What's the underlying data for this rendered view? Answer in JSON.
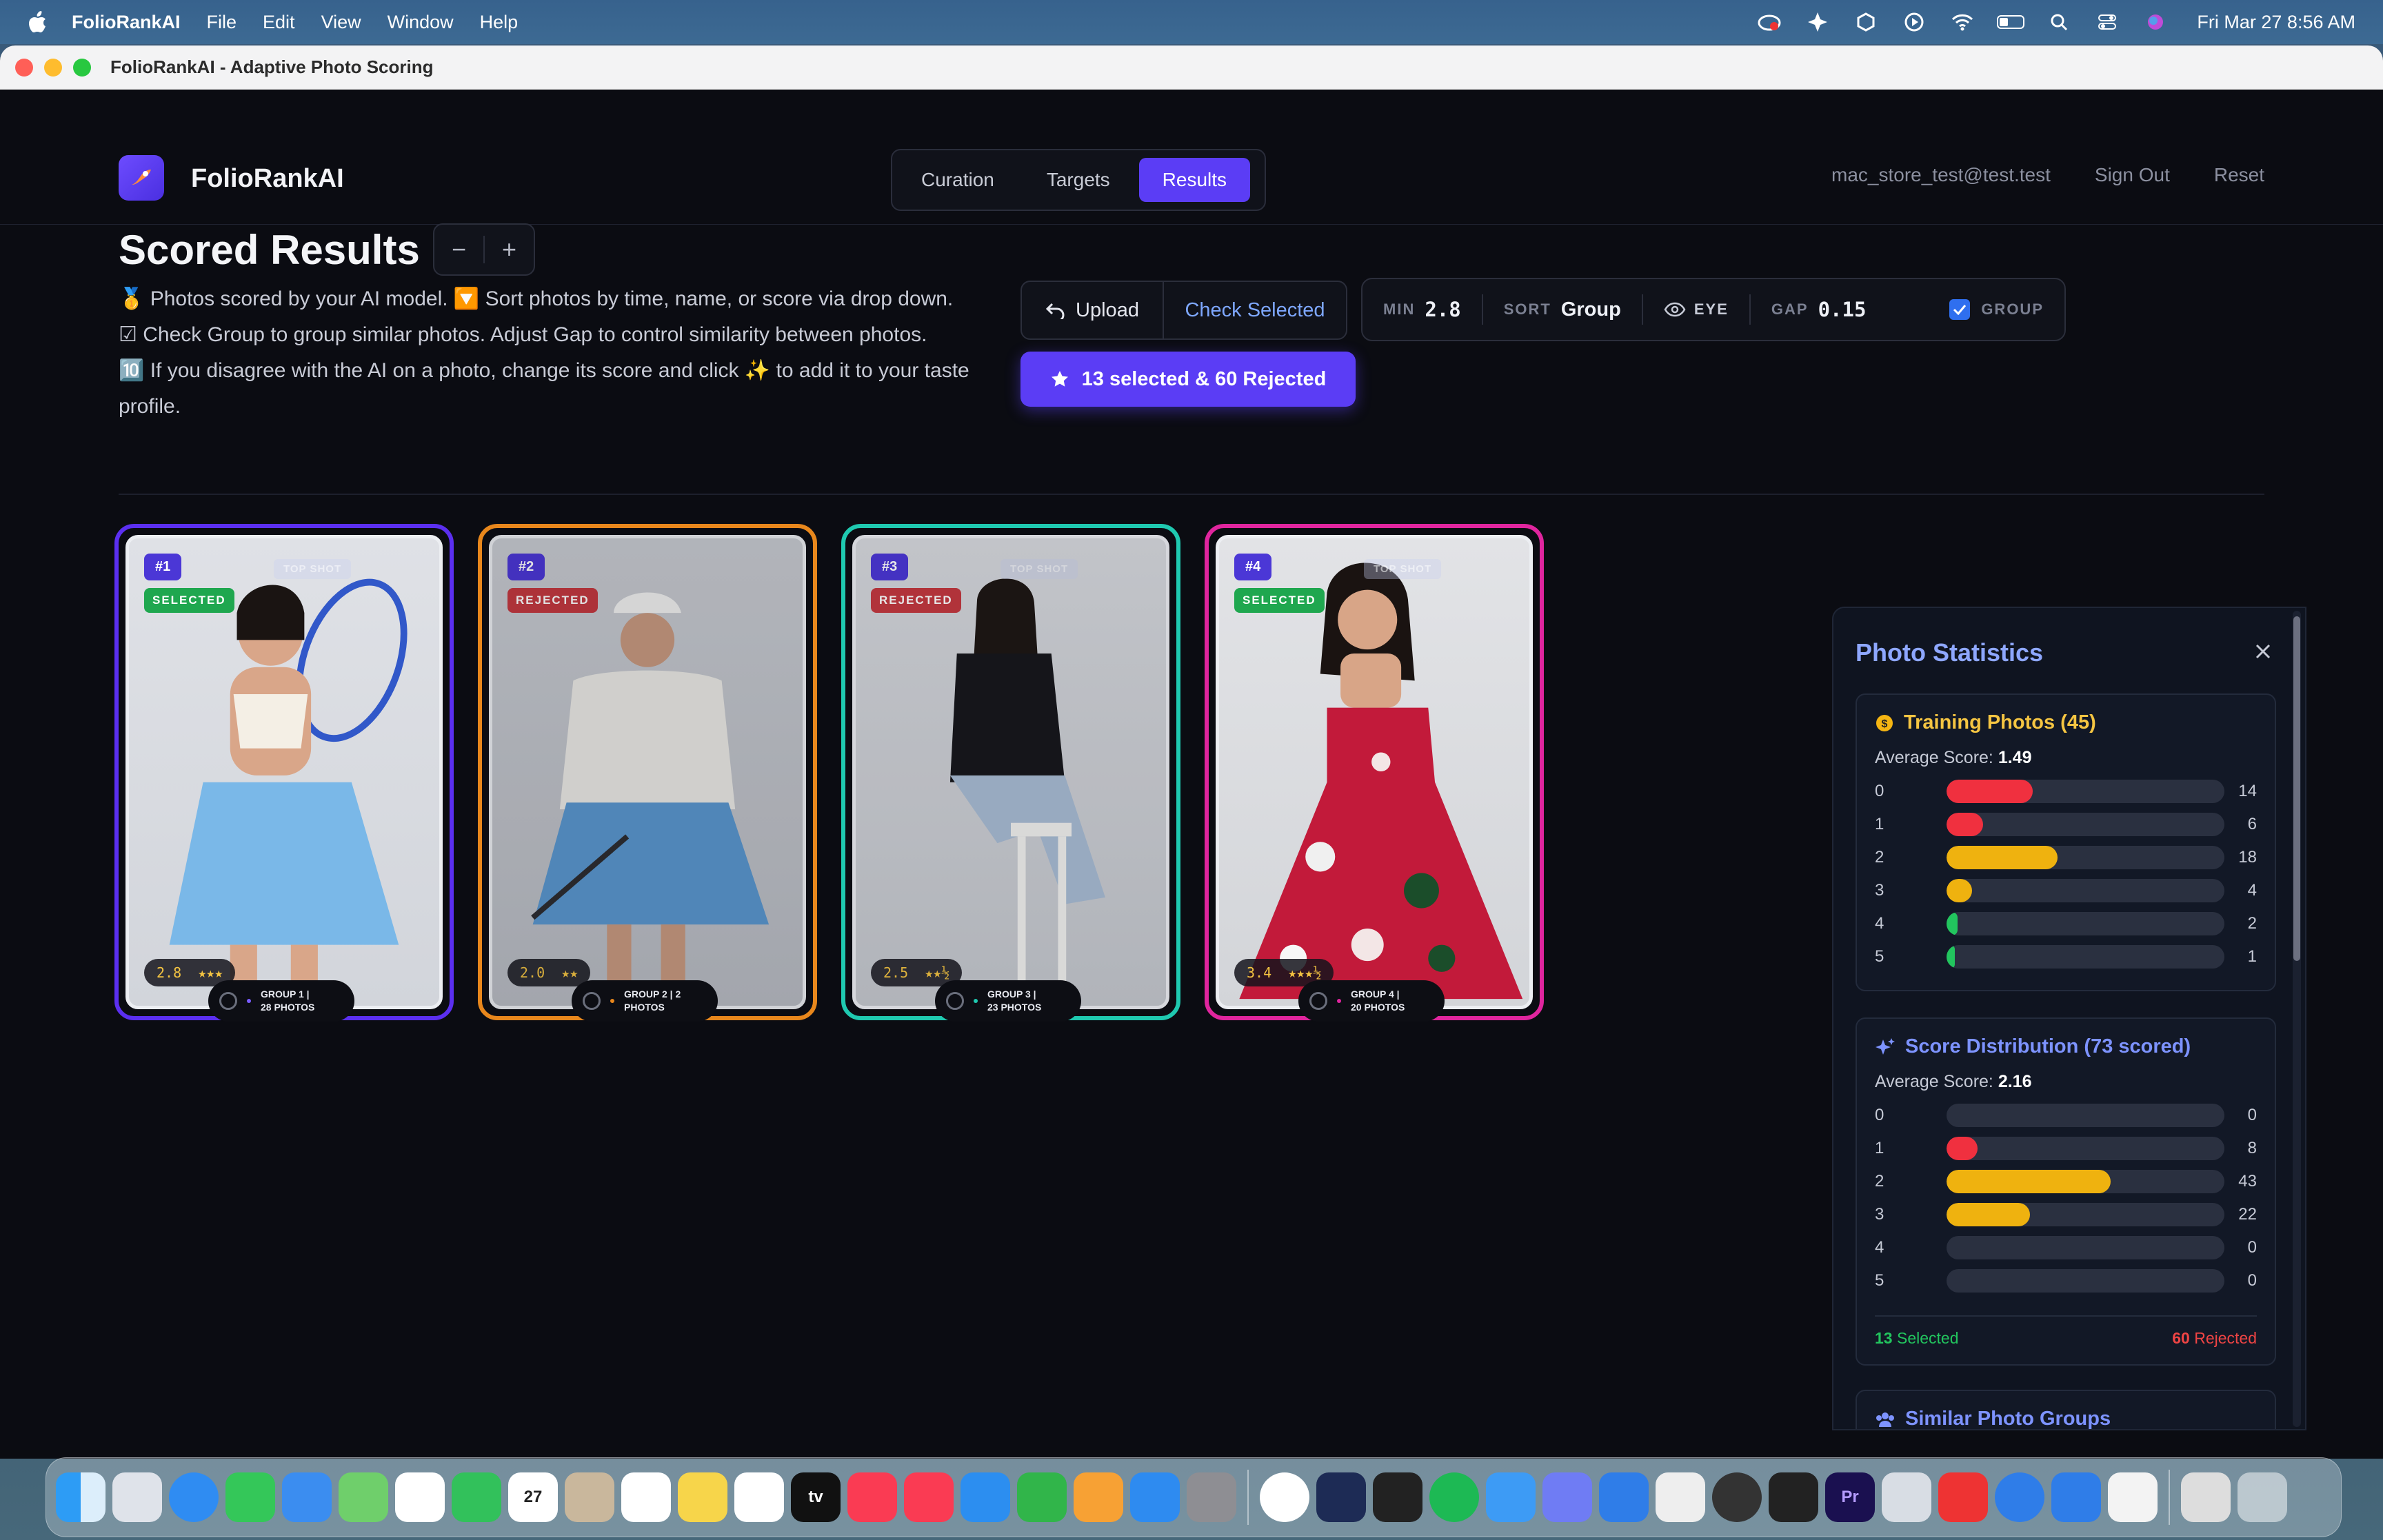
{
  "menubar": {
    "app_name": "FolioRankAI",
    "menus": [
      "File",
      "Edit",
      "View",
      "Window",
      "Help"
    ],
    "clock": "Fri Mar 27  8:56 AM"
  },
  "window": {
    "title": "FolioRankAI - Adaptive Photo Scoring"
  },
  "header": {
    "brand": "FolioRankAI",
    "tabs": [
      {
        "label": "Curation",
        "active": false
      },
      {
        "label": "Targets",
        "active": false
      },
      {
        "label": "Results",
        "active": true
      }
    ],
    "user_email": "mac_store_test@test.test",
    "sign_out": "Sign Out",
    "reset": "Reset"
  },
  "main": {
    "title": "Scored Results",
    "zoom_minus": "−",
    "zoom_plus": "+",
    "description": [
      "🥇 Photos scored by your AI model. 🔽 Sort photos by time, name, or score via drop down.",
      "☑ Check Group to group similar photos. Adjust Gap to control similarity between photos.",
      "🔟 If you disagree with the AI on a photo, change its score and click ✨ to add it to your taste profile."
    ],
    "upload_label": "Upload",
    "check_selected_label": "Check Selected",
    "filters": {
      "min_label": "MIN",
      "min_value": "2.8",
      "sort_label": "SORT",
      "sort_value": "Group",
      "eye_label": "EYE",
      "gap_label": "GAP",
      "gap_value": "0.15",
      "group_label": "GROUP",
      "group_checked": true
    },
    "selected_summary": "13 selected & 60 Rejected"
  },
  "cards": [
    {
      "rank": "#1",
      "status": "SELECTED",
      "top_shot": "TOP SHOT",
      "score": "2.8",
      "stars": "★★★",
      "group_line1": "GROUP 1 |",
      "group_line2": "28 PHOTOS",
      "border": "#5b2ff0"
    },
    {
      "rank": "#2",
      "status": "REJECTED",
      "top_shot": "",
      "score": "2.0",
      "stars": "★★",
      "group_line1": "GROUP 2 | 2",
      "group_line2": "PHOTOS",
      "border": "#e8871c"
    },
    {
      "rank": "#3",
      "status": "REJECTED",
      "top_shot": "TOP SHOT",
      "score": "2.5",
      "stars": "★★½",
      "group_line1": "GROUP 3 |",
      "group_line2": "23 PHOTOS",
      "border": "#1fc9b0"
    },
    {
      "rank": "#4",
      "status": "SELECTED",
      "top_shot": "TOP SHOT",
      "score": "3.4",
      "stars": "★★★½",
      "group_line1": "GROUP 4 |",
      "group_line2": "20 PHOTOS",
      "border": "#e0259e"
    }
  ],
  "stats": {
    "title": "Photo Statistics",
    "training": {
      "heading": "Training Photos (45)",
      "avg_label": "Average Score:",
      "avg_value": "1.49",
      "rows": [
        {
          "k": "0",
          "n": "14",
          "pct": 31,
          "color": "#f0303f"
        },
        {
          "k": "1",
          "n": "6",
          "pct": 13,
          "color": "#f0303f"
        },
        {
          "k": "2",
          "n": "18",
          "pct": 40,
          "color": "#efb20f"
        },
        {
          "k": "3",
          "n": "4",
          "pct": 9,
          "color": "#efb20f"
        },
        {
          "k": "4",
          "n": "2",
          "pct": 4,
          "color": "#22c55e"
        },
        {
          "k": "5",
          "n": "1",
          "pct": 2,
          "color": "#22c55e"
        }
      ]
    },
    "distribution": {
      "heading": "Score Distribution (73 scored)",
      "avg_label": "Average Score:",
      "avg_value": "2.16",
      "rows": [
        {
          "k": "0",
          "n": "0",
          "pct": 0,
          "color": "#f0303f"
        },
        {
          "k": "1",
          "n": "8",
          "pct": 11,
          "color": "#f0303f"
        },
        {
          "k": "2",
          "n": "43",
          "pct": 59,
          "color": "#efb20f"
        },
        {
          "k": "3",
          "n": "22",
          "pct": 30,
          "color": "#efb20f"
        },
        {
          "k": "4",
          "n": "0",
          "pct": 0,
          "color": "#22c55e"
        },
        {
          "k": "5",
          "n": "0",
          "pct": 0,
          "color": "#22c55e"
        }
      ],
      "selected_count": "13",
      "selected_label": "Selected",
      "rejected_count": "60",
      "rejected_label": "Rejected"
    },
    "similar_groups": "Similar Photo Groups"
  }
}
